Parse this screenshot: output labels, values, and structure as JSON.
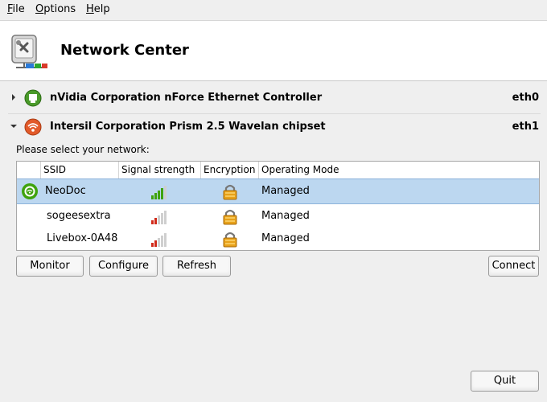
{
  "menu": [
    {
      "accel": "F",
      "rest": "ile"
    },
    {
      "accel": "O",
      "rest": "ptions"
    },
    {
      "accel": "H",
      "rest": "elp"
    }
  ],
  "header": {
    "title": "Network Center",
    "icon": "network-tools-icon"
  },
  "devices": [
    {
      "label": "nVidia Corporation nForce Ethernet Controller",
      "interface": "eth0",
      "expanded": false,
      "icon": "ethernet-icon",
      "color": "#4a9a2a"
    },
    {
      "label": "Intersil Corporation Prism 2.5 Wavelan chipset",
      "interface": "eth1",
      "expanded": true,
      "icon": "wireless-icon",
      "color": "#e25a2a"
    }
  ],
  "wifi": {
    "prompt": "Please select your network:",
    "columns": [
      "SSID",
      "Signal strength",
      "Encryption",
      "Operating Mode"
    ],
    "networks": [
      {
        "ssid": "NeoDoc",
        "signal": 0.8,
        "encrypted": true,
        "mode": "Managed",
        "selected": true,
        "connected_icon": true
      },
      {
        "ssid": "sogeesextra",
        "signal": 0.2,
        "encrypted": true,
        "mode": "Managed",
        "selected": false,
        "connected_icon": false
      },
      {
        "ssid": "Livebox-0A48",
        "signal": 0.2,
        "encrypted": true,
        "mode": "Managed",
        "selected": false,
        "connected_icon": false
      }
    ]
  },
  "buttons": {
    "monitor": "Monitor",
    "configure": "Configure",
    "refresh": "Refresh",
    "connect": "Connect",
    "quit": "Quit"
  },
  "colors": {
    "selection": "#bcd7f0",
    "signal_green": "#3fa30e",
    "signal_red": "#d12a1a",
    "lock": "#e8a21a"
  }
}
